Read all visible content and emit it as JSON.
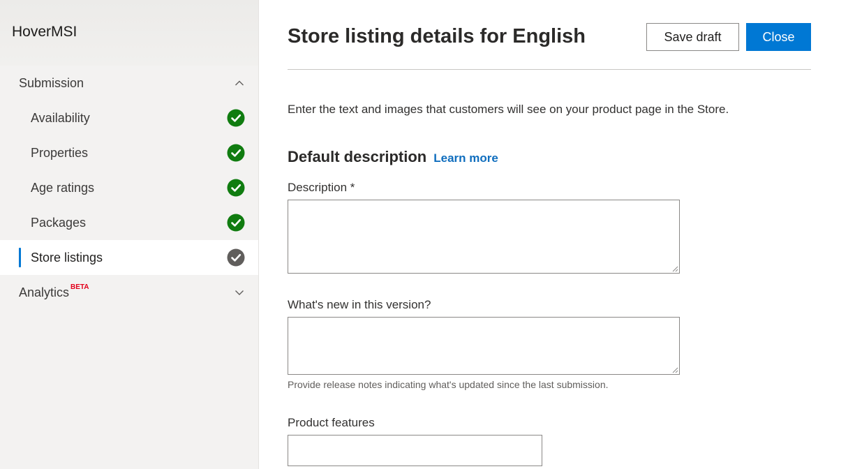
{
  "app": {
    "title": "HoverMSI"
  },
  "sidebar": {
    "submission": {
      "label": "Submission",
      "items": [
        {
          "label": "Availability",
          "status": "complete"
        },
        {
          "label": "Properties",
          "status": "complete"
        },
        {
          "label": "Age ratings",
          "status": "complete"
        },
        {
          "label": "Packages",
          "status": "complete"
        },
        {
          "label": "Store listings",
          "status": "in-progress",
          "active": true
        }
      ]
    },
    "analytics": {
      "label": "Analytics",
      "badge": "BETA"
    }
  },
  "header": {
    "title": "Store listing details for English",
    "save_draft_label": "Save draft",
    "close_label": "Close"
  },
  "main": {
    "intro": "Enter the text and images that customers will see on your product page in the Store.",
    "default_description": {
      "heading": "Default description",
      "learn_more": "Learn more"
    },
    "fields": {
      "description": {
        "label": "Description *",
        "value": ""
      },
      "whats_new": {
        "label": "What's new in this version?",
        "value": "",
        "helper": "Provide release notes indicating what's updated since the last submission."
      },
      "product_features": {
        "label": "Product features",
        "value": ""
      }
    }
  },
  "colors": {
    "accent": "#0078d4",
    "complete": "#107c10",
    "in_progress": "#605e5c",
    "beta": "#e3001b",
    "link": "#106ebe"
  }
}
